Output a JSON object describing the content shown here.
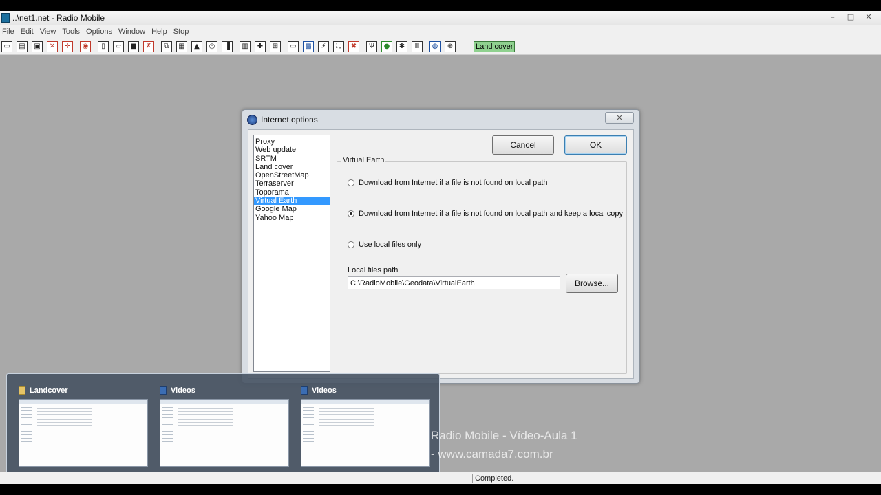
{
  "window": {
    "title": "..\\net1.net - Radio Mobile",
    "controls": [
      "–",
      "□",
      "✕"
    ]
  },
  "menu": [
    "File",
    "Edit",
    "View",
    "Tools",
    "Options",
    "Window",
    "Help",
    "Stop"
  ],
  "toolbar": {
    "landcover_label": "Land cover"
  },
  "dialog": {
    "title": "Internet options",
    "close_glyph": "✕",
    "list_items": [
      "Proxy",
      "Web update",
      "SRTM",
      "Land cover",
      "OpenStreetMap",
      "Terraserver",
      "Toporama",
      "Virtual Earth",
      "Google Map",
      "Yahoo Map"
    ],
    "selected_item": "Virtual Earth",
    "cancel_label": "Cancel",
    "ok_label": "OK",
    "group_title": "Virtual Earth",
    "radio_options": [
      "Download from Internet if a file is not found on local path",
      "Download from Internet if a file is not found on local path and keep a local copy",
      "Use local files only"
    ],
    "selected_option": 1,
    "local_path_label": "Local files path",
    "local_path_value": "C:\\RadioMobile\\Geodata\\VirtualEarth",
    "browse_label": "Browse..."
  },
  "taskbar_thumbnails": [
    {
      "title": "Landcover",
      "icon": "folder-icon"
    },
    {
      "title": "Videos",
      "icon": "video-icon"
    },
    {
      "title": "Videos",
      "icon": "video-icon"
    }
  ],
  "watermark": {
    "line1": "Radio Mobile - Vídeo-Aula 1",
    "line2": "- www.camada7.com.br"
  },
  "status": {
    "text": "Completed."
  }
}
